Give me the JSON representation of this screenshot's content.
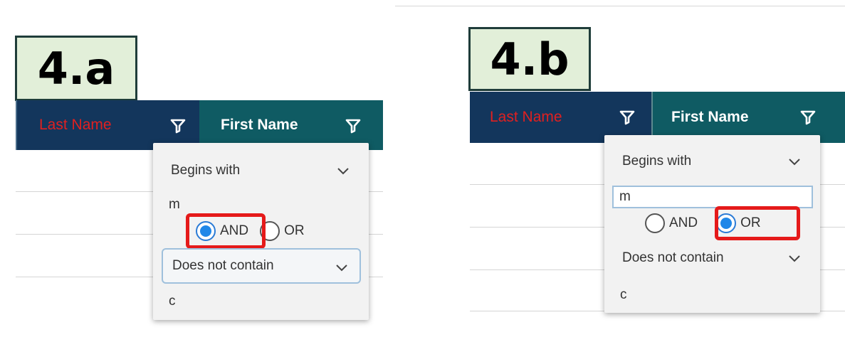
{
  "panels": [
    {
      "label": "4.a",
      "columns": {
        "last_name": "Last Name",
        "first_name": "First Name"
      },
      "filter": {
        "condition1": "Begins with",
        "value1": "m",
        "operator_options": [
          "AND",
          "OR"
        ],
        "selected_operator": "AND",
        "condition2": "Does not contain",
        "value2": "c"
      }
    },
    {
      "label": "4.b",
      "columns": {
        "last_name": "Last Name",
        "first_name": "First Name"
      },
      "filter": {
        "condition1": "Begins with",
        "value1": "m",
        "operator_options": [
          "AND",
          "OR"
        ],
        "selected_operator": "OR",
        "condition2": "Does not contain",
        "value2": "c"
      }
    }
  ],
  "colors": {
    "header_last_bg": "#13365c",
    "header_first_bg": "#0f5b63",
    "last_name_text": "#e02020",
    "label_bg": "#e2efd9",
    "highlight": "#e51a1a",
    "radio_selected": "#1f87e8"
  },
  "icons": {
    "filter": "filter-funnel-icon",
    "dropdown": "chevron-down-icon"
  }
}
